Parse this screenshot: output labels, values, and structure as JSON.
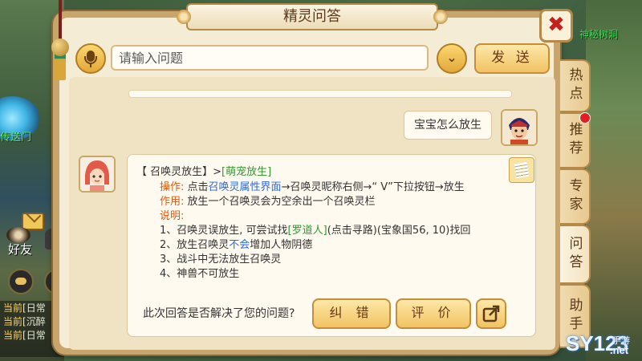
{
  "dialog": {
    "title": "精灵问答",
    "close_glyph": "✖"
  },
  "input": {
    "placeholder": "请输入问题",
    "send_label": "发 送",
    "dropdown_glyph": "⌄"
  },
  "conversation": {
    "user_question": "宝宝怎么放生",
    "answer": {
      "heading_prefix": "【 召唤灵放生】>",
      "heading_link": "[萌宠放生]",
      "op_label": "操作:",
      "op_prefix": "点击",
      "op_link": "召唤灵属性界面",
      "op_suffix": "→召唤灵昵称右侧→“ V”下拉按钮→放生",
      "effect_label": "作用:",
      "effect_text": "放生一个召唤灵会为空余出一个召唤灵栏",
      "note_label": "说明:",
      "note1_prefix": "1、召唤灵误放生, 可尝试找",
      "note1_link": "[罗道人]",
      "note1_suffix": "(点击寻路)(宝象国56, 10)找回",
      "note2_prefix": "2、放生召唤灵",
      "note2_link": "不会",
      "note2_suffix": "增加人物阴德",
      "note3": "3、战斗中无法放生召唤灵",
      "note4": "4、神兽不可放生"
    }
  },
  "feedback": {
    "question": "此次回答是否解决了您的问题?",
    "correct_label": "纠 错",
    "rate_label": "评 价"
  },
  "side_tabs": [
    {
      "label": "热点"
    },
    {
      "label": "推荐"
    },
    {
      "label": "专家"
    },
    {
      "label": "问答"
    },
    {
      "label": "助手"
    }
  ],
  "background": {
    "portal_label": "传送门",
    "map_label": "神秘树洞",
    "friend_label": "好友",
    "quests": [
      {
        "prefix": "当前",
        "text": "[日常"
      },
      {
        "prefix": "当前",
        "text": "[沉醉"
      },
      {
        "prefix": "当前",
        "text": "[日常"
      }
    ]
  },
  "watermark": {
    "main": "SY123",
    "sub": "手游",
    "net": ".net"
  },
  "colors": {
    "link_green": "#2e9a2e",
    "label_orange": "#e05a10",
    "link_blue": "#2a6ad8",
    "close_red": "#c81e1e"
  }
}
